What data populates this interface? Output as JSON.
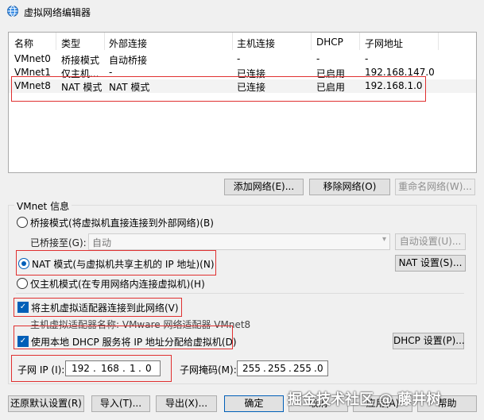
{
  "window": {
    "title": "虚拟网络编辑器",
    "icon": "network-globe-icon"
  },
  "table": {
    "headers": [
      "名称",
      "类型",
      "外部连接",
      "主机连接",
      "DHCP",
      "子网地址"
    ],
    "rows": [
      [
        "VMnet0",
        "桥接模式",
        "自动桥接",
        "-",
        "-",
        "-"
      ],
      [
        "VMnet1",
        "仅主机...",
        "-",
        "已连接",
        "已启用",
        "192.168.147.0"
      ],
      [
        "VMnet8",
        "NAT 模式",
        "NAT 模式",
        "已连接",
        "已启用",
        "192.168.1.0"
      ]
    ],
    "selected_row": 2
  },
  "network_buttons": {
    "add": "添加网络(E)...",
    "remove": "移除网络(O)",
    "rename": "重命名网络(W)..."
  },
  "vmnet_info": {
    "title": "VMnet 信息",
    "bridged_label": "桥接模式(将虚拟机直接连接到外部网络)(B)",
    "bridged_to_label": "已桥接至(G):",
    "bridged_to_value": "自动",
    "auto_settings": "自动设置(U)...",
    "nat_label": "NAT 模式(与虚拟机共享主机的 IP 地址)(N)",
    "nat_settings": "NAT 设置(S)...",
    "hostonly_label": "仅主机模式(在专用网络内连接虚拟机)(H)",
    "connect_adapter_label": "将主机虚拟适配器连接到此网络(V)",
    "adapter_name_label": "主机虚拟适配器名称: VMware 网络适配器 VMnet8",
    "dhcp_label": "使用本地 DHCP 服务将 IP 地址分配给虚拟机(D)",
    "dhcp_settings": "DHCP 设置(P)...",
    "subnet_ip_label": "子网 IP (I):",
    "subnet_ip": [
      "192",
      "168",
      "1",
      "0"
    ],
    "subnet_mask_label": "子网掩码(M):",
    "subnet_mask": [
      "255",
      "255",
      "255",
      "0"
    ],
    "selected_mode": "nat",
    "connect_adapter_checked": true,
    "dhcp_checked": true
  },
  "bottom_buttons": {
    "restore": "还原默认设置(R)",
    "import": "导入(T)...",
    "export": "导出(X)...",
    "ok": "确定",
    "cancel": "取消",
    "apply": "应用(A)",
    "help": "帮助"
  },
  "watermark": "掘金技术社区 @ 藤井树"
}
